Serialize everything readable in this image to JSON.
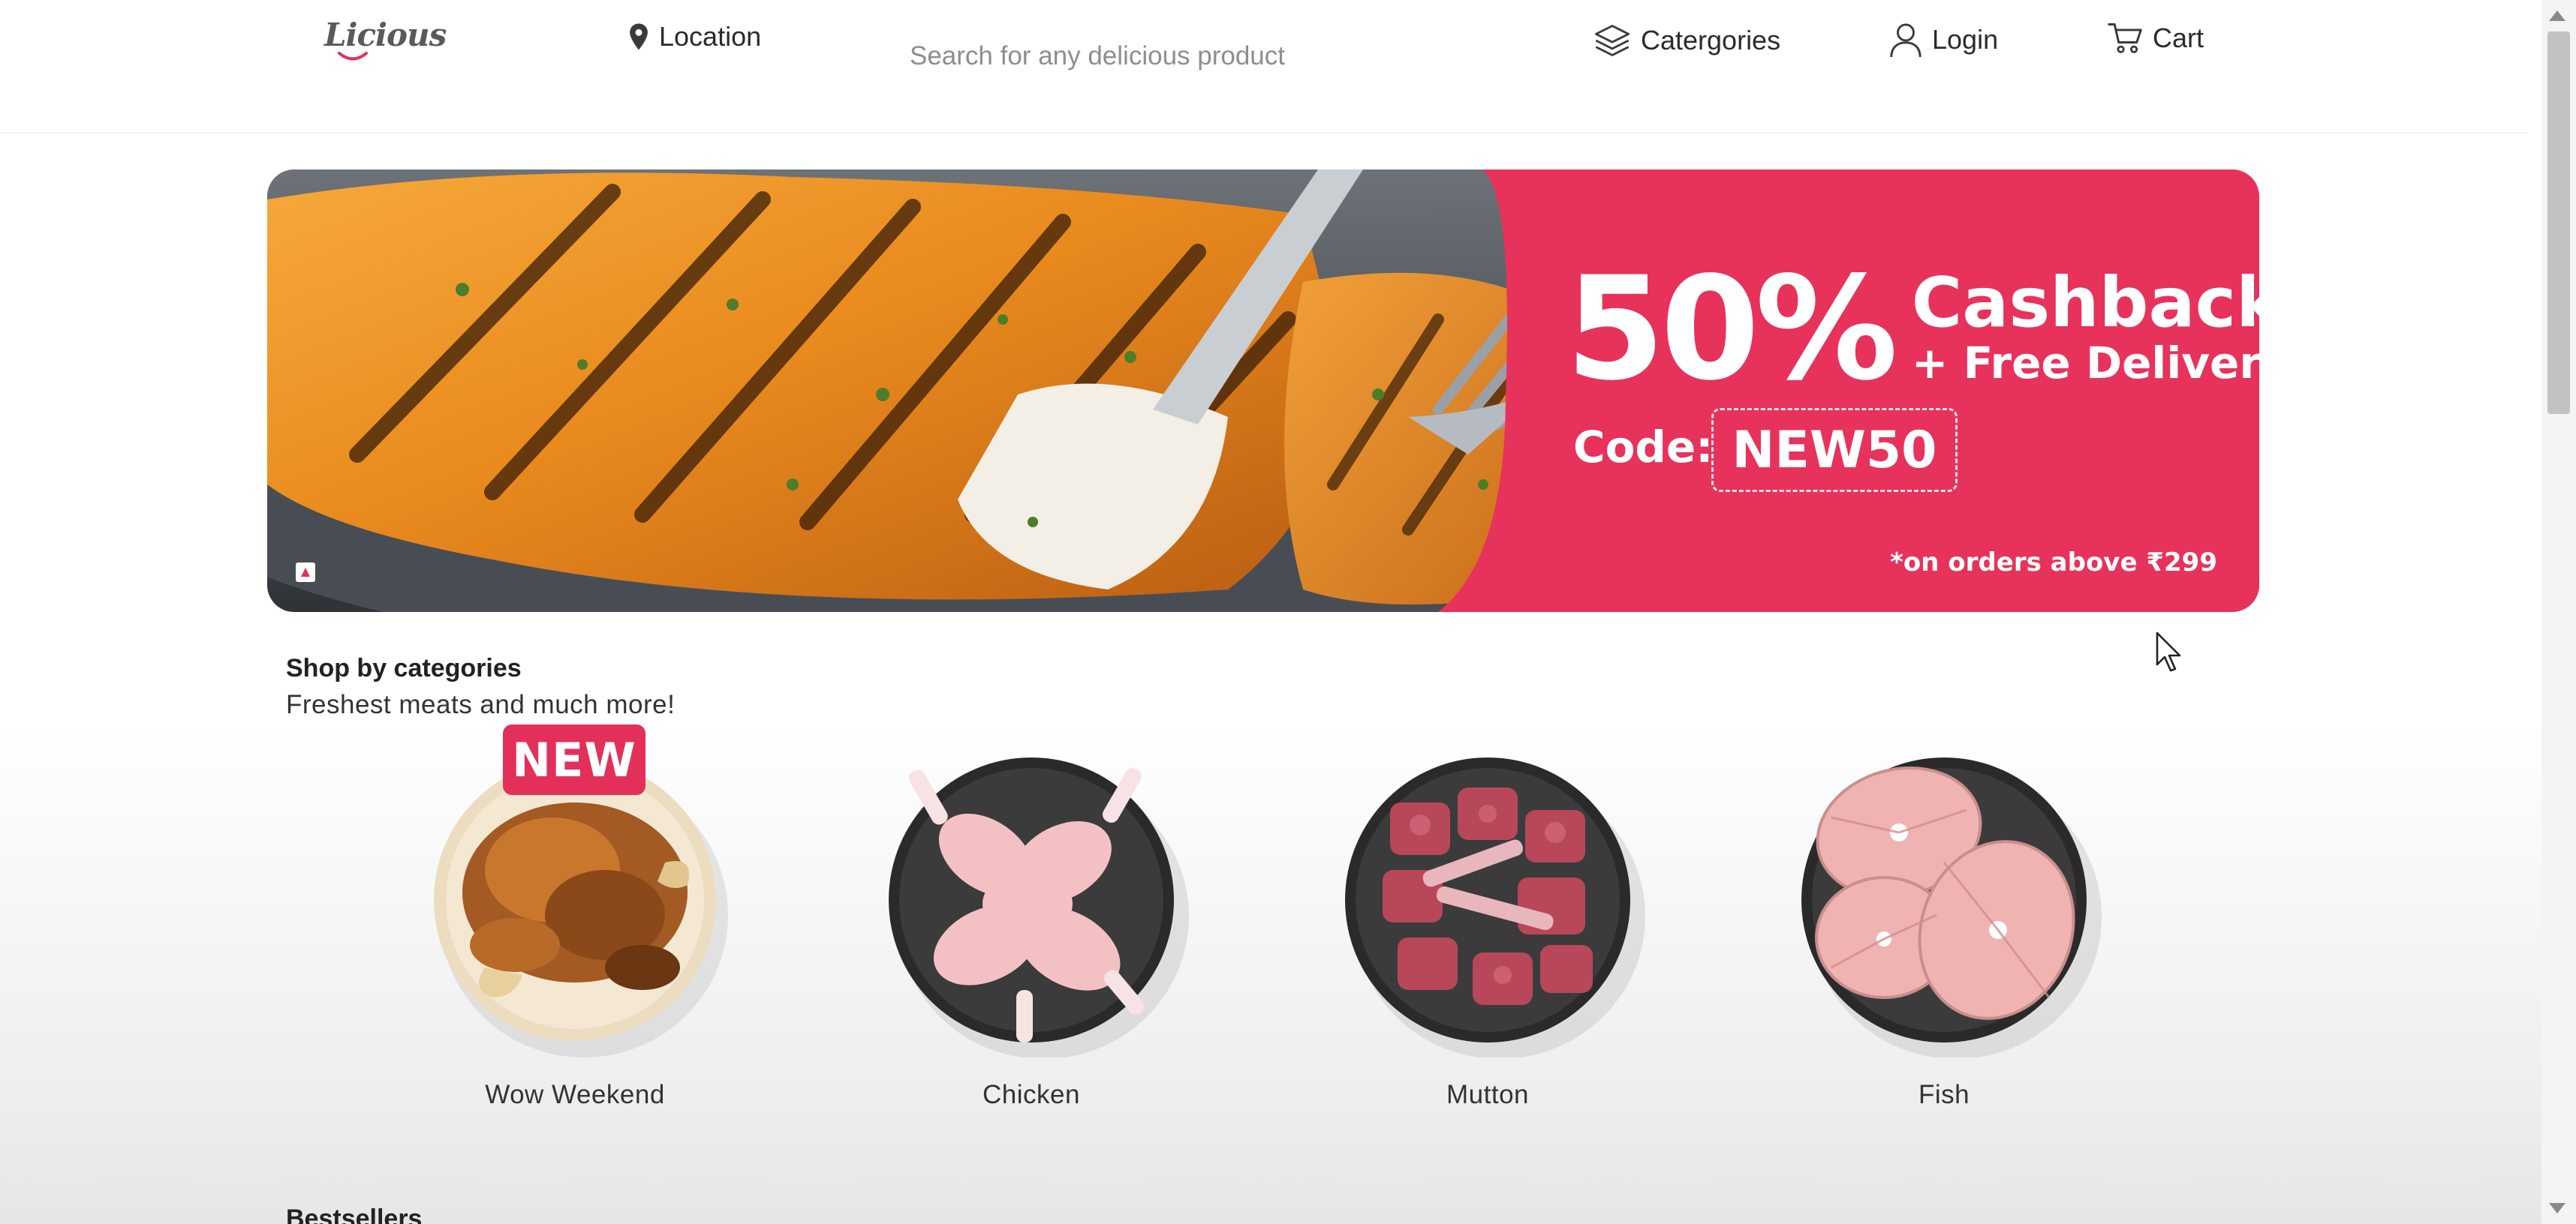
{
  "header": {
    "logo": "Licious",
    "location_label": "Location",
    "search_placeholder": "Search for any delicious product",
    "categories_label": "Catergories",
    "login_label": "Login",
    "cart_label": "Cart"
  },
  "banner": {
    "percent": "50%",
    "cashback": "Cashback",
    "cashback_star": "*",
    "free_delivery": "+ Free Delivery",
    "code_label": "Code:",
    "code": "NEW50",
    "note": "*on orders above ₹299",
    "accent_color": "#e7325b"
  },
  "categories": {
    "title": "Shop by categories",
    "subtitle": "Freshest meats and much more!",
    "items": [
      {
        "label": "Wow Weekend",
        "badge": "NEW"
      },
      {
        "label": "Chicken"
      },
      {
        "label": "Mutton"
      },
      {
        "label": "Fish"
      }
    ]
  },
  "next_section": {
    "title": "Bestsellers"
  },
  "icons": {
    "location": "location-pin-icon",
    "categories": "layers-icon",
    "login": "user-icon",
    "cart": "cart-icon"
  }
}
